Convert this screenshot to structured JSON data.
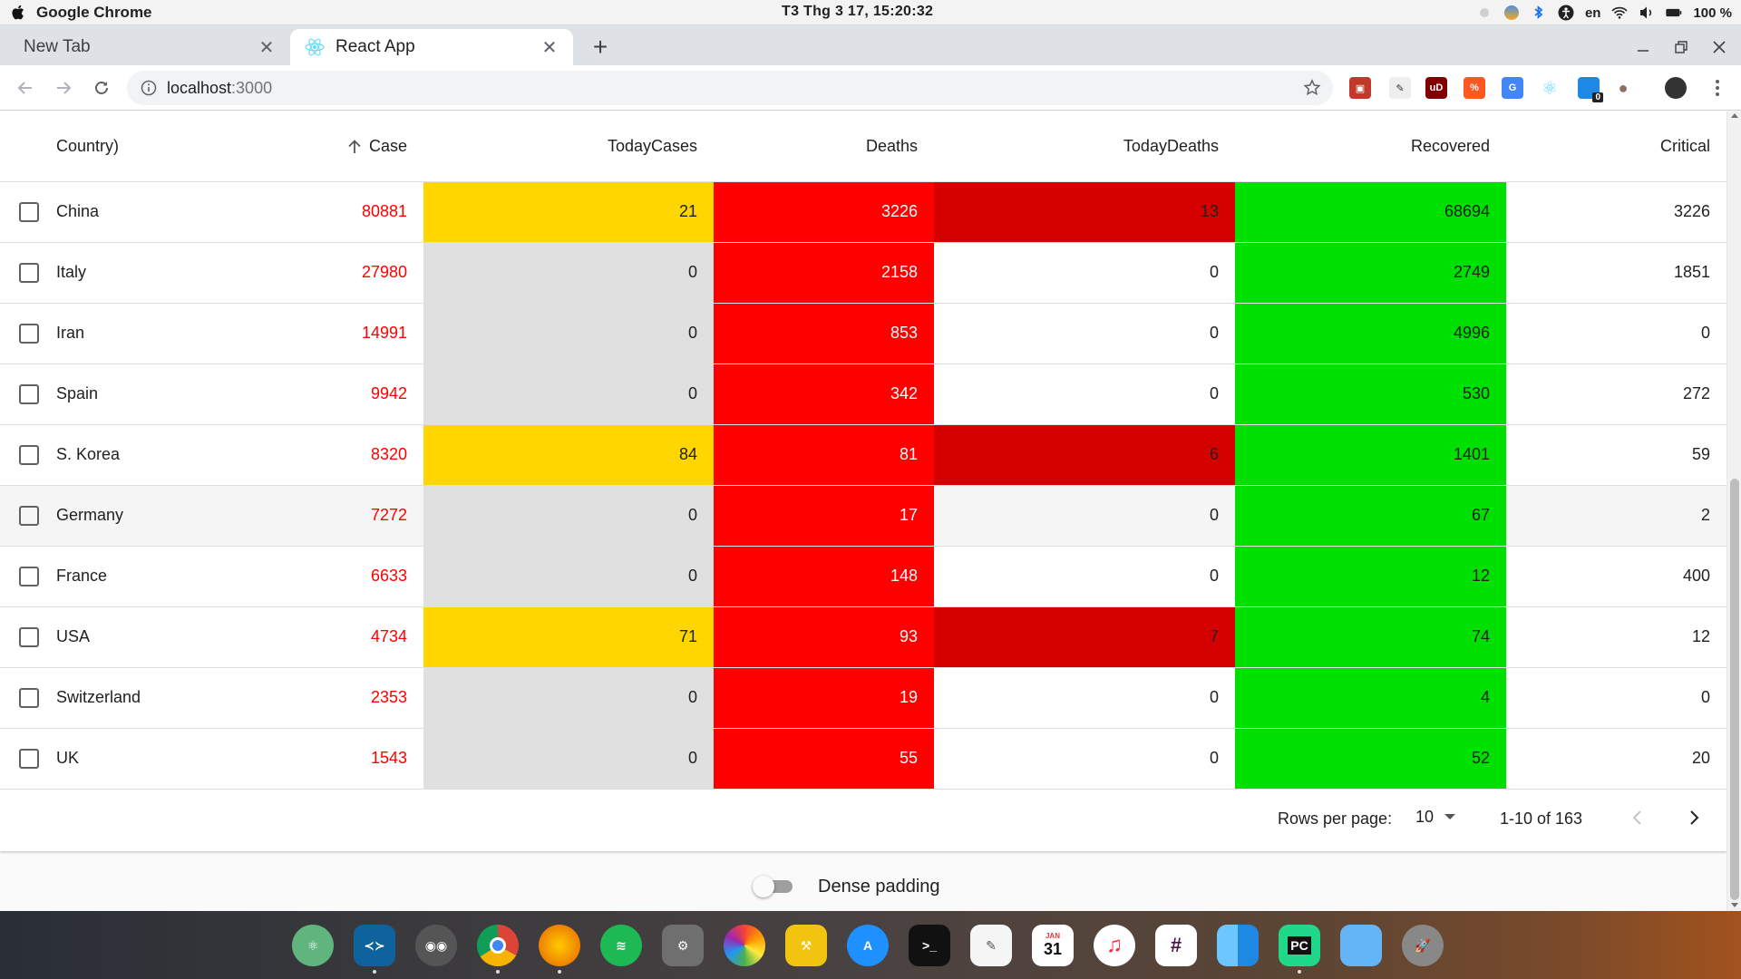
{
  "menubar": {
    "app_name": "Google Chrome",
    "clock": "T3 Thg 3 17, 15:20:32",
    "language": "en",
    "battery": "100 %"
  },
  "browser": {
    "tabs": [
      {
        "label": "New Tab",
        "active": false
      },
      {
        "label": "React App",
        "active": true
      }
    ],
    "url_host": "localhost",
    "url_port": ":3000",
    "extension_badge_count": "0"
  },
  "table": {
    "columns": [
      "Country)",
      "Case",
      "TodayCases",
      "Deaths",
      "TodayDeaths",
      "Recovered",
      "Critical"
    ],
    "sorted_column": "Case",
    "colors": {
      "case_text": "#ff0000",
      "today_cases_nonzero": "#ffd600",
      "today_cases_zero": "#e0e0e0",
      "deaths": "#ff0000",
      "today_deaths_nonzero": "#d50000",
      "recovered": "#00e000"
    },
    "rows": [
      {
        "country": "China",
        "case": "80881",
        "todayCases": "21",
        "deaths": "3226",
        "todayDeaths": "13",
        "recovered": "68694",
        "critical": "3226"
      },
      {
        "country": "Italy",
        "case": "27980",
        "todayCases": "0",
        "deaths": "2158",
        "todayDeaths": "0",
        "recovered": "2749",
        "critical": "1851"
      },
      {
        "country": "Iran",
        "case": "14991",
        "todayCases": "0",
        "deaths": "853",
        "todayDeaths": "0",
        "recovered": "4996",
        "critical": "0"
      },
      {
        "country": "Spain",
        "case": "9942",
        "todayCases": "0",
        "deaths": "342",
        "todayDeaths": "0",
        "recovered": "530",
        "critical": "272"
      },
      {
        "country": "S. Korea",
        "case": "8320",
        "todayCases": "84",
        "deaths": "81",
        "todayDeaths": "6",
        "recovered": "1401",
        "critical": "59"
      },
      {
        "country": "Germany",
        "case": "7272",
        "todayCases": "0",
        "deaths": "17",
        "todayDeaths": "0",
        "recovered": "67",
        "critical": "2"
      },
      {
        "country": "France",
        "case": "6633",
        "todayCases": "0",
        "deaths": "148",
        "todayDeaths": "0",
        "recovered": "12",
        "critical": "400"
      },
      {
        "country": "USA",
        "case": "4734",
        "todayCases": "71",
        "deaths": "93",
        "todayDeaths": "7",
        "recovered": "74",
        "critical": "12"
      },
      {
        "country": "Switzerland",
        "case": "2353",
        "todayCases": "0",
        "deaths": "19",
        "todayDeaths": "0",
        "recovered": "4",
        "critical": "0"
      },
      {
        "country": "UK",
        "case": "1543",
        "todayCases": "0",
        "deaths": "55",
        "todayDeaths": "0",
        "recovered": "52",
        "critical": "20"
      }
    ]
  },
  "pagination": {
    "rows_per_page_label": "Rows per page:",
    "rows_per_page_value": "10",
    "range": "1-10 of 163"
  },
  "dense_toggle": {
    "label": "Dense padding",
    "checked": false
  },
  "dock": {
    "calendar_month": "JAN",
    "calendar_day": "31",
    "apps": [
      "atom-icon",
      "vscode-icon",
      "owl-icon",
      "chrome-icon",
      "firefox-icon",
      "spotify-icon",
      "system-preferences-icon",
      "photos-icon",
      "xcode-icon",
      "app-store-icon",
      "terminal-icon",
      "textedit-icon",
      "calendar-icon",
      "music-icon",
      "slack-icon",
      "finder-icon",
      "pycharm-icon",
      "folder-icon",
      "launchpad-icon"
    ]
  }
}
